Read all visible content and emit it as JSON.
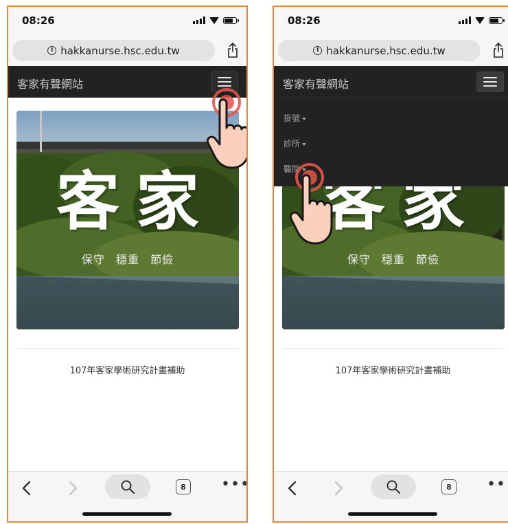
{
  "status_bar": {
    "time": "08:26"
  },
  "browser": {
    "url": "hakkanurse.hsc.edu.tw",
    "tab_count": "8"
  },
  "site": {
    "brand": "客家有聲網站",
    "hero_title": "客家",
    "hero_subtitle": [
      "保守",
      "穩重",
      "節儉"
    ],
    "footer": "107年客家學術研究計畫補助"
  },
  "menu": {
    "items": [
      "掛號",
      "診所",
      "醫院"
    ]
  },
  "colors": {
    "navbar": "#222222",
    "accent_border": "#e5883e",
    "tap_ring": "#e8554a",
    "hand_fill": "#fbd1bd"
  },
  "icons": [
    "info-icon",
    "share-icon",
    "hamburger-icon",
    "back-icon",
    "forward-icon",
    "search-icon",
    "tabs-icon",
    "more-icon",
    "tap-ring-icon",
    "hand-pointer-icon"
  ]
}
